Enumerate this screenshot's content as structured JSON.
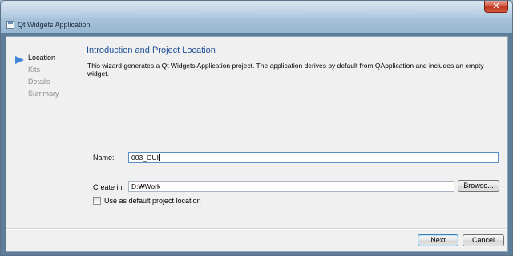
{
  "window": {
    "title": "Qt Widgets Application",
    "close_glyph": "✕"
  },
  "sidebar": {
    "steps": [
      {
        "label": "Location",
        "active": true
      },
      {
        "label": "Kits",
        "active": false
      },
      {
        "label": "Details",
        "active": false
      },
      {
        "label": "Summary",
        "active": false
      }
    ]
  },
  "page": {
    "title": "Introduction and Project Location",
    "description": "This wizard generates a Qt Widgets Application project. The application derives by default from QApplication and includes an empty widget."
  },
  "form": {
    "name_label": "Name:",
    "name_value": "003_GUI",
    "create_in_label": "Create in:",
    "create_in_value": "D:₩Work",
    "browse_label": "Browse...",
    "default_location_label": "Use as default project location",
    "default_location_checked": false
  },
  "footer": {
    "next_label": "Next",
    "cancel_label": "Cancel"
  },
  "colors": {
    "accent": "#1e4f95",
    "step_arrow": "#3f86d6",
    "close_button": "#c0381f"
  },
  "icons": {
    "window_icon": "window-icon",
    "step_indicator": "arrow-right-icon",
    "close": "close-icon"
  }
}
